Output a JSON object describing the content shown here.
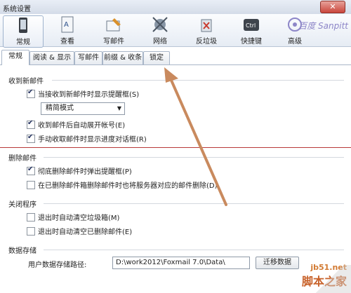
{
  "window": {
    "title": "系统设置",
    "close_label": "✕"
  },
  "toolbar": {
    "items": [
      {
        "label": "常规",
        "icon": "phone-icon"
      },
      {
        "label": "查看",
        "icon": "document-icon"
      },
      {
        "label": "写邮件",
        "icon": "compose-icon"
      },
      {
        "label": "网络",
        "icon": "satellite-icon"
      },
      {
        "label": "反垃圾",
        "icon": "trash-shield-icon"
      },
      {
        "label": "快捷键",
        "icon": "ctrl-key-icon"
      },
      {
        "label": "高级",
        "icon": "advanced-icon"
      }
    ]
  },
  "tabs": [
    {
      "label": "常规"
    },
    {
      "label": "阅读 & 显示"
    },
    {
      "label": "写邮件"
    },
    {
      "label": "前缀 & 收条"
    },
    {
      "label": "锁定"
    }
  ],
  "sections": {
    "receive": {
      "title": "收到新邮件",
      "opt1": "当接收到新邮件时显示提醒框(S)",
      "mode_value": "精简模式",
      "opt2": "收到邮件后自动展开帐号(E)",
      "opt3": "手动收取邮件时显示进度对话框(R)"
    },
    "delete": {
      "title": "删除邮件",
      "opt1": "彻底删除邮件时弹出提醒框(P)",
      "opt2": "在已删除邮件箱删除邮件时也将服务器对应的邮件删除(D)"
    },
    "close": {
      "title": "关闭程序",
      "opt1": "退出时自动清空垃圾箱(M)",
      "opt2": "退出时自动清空已删除邮件(E)"
    },
    "storage": {
      "title": "数据存储",
      "path_label": "用户数据存储路径:",
      "path_value": "D:\\work2012\\Foxmail 7.0\\Data\\",
      "migrate_button": "迁移数据"
    }
  },
  "watermarks": {
    "top_right": "百度 Sanpitt",
    "site": "jb51.net",
    "name": "脚本之家"
  },
  "colors": {
    "annotation_arrow": "#c98a5e",
    "red_line": "#b83a3a"
  }
}
